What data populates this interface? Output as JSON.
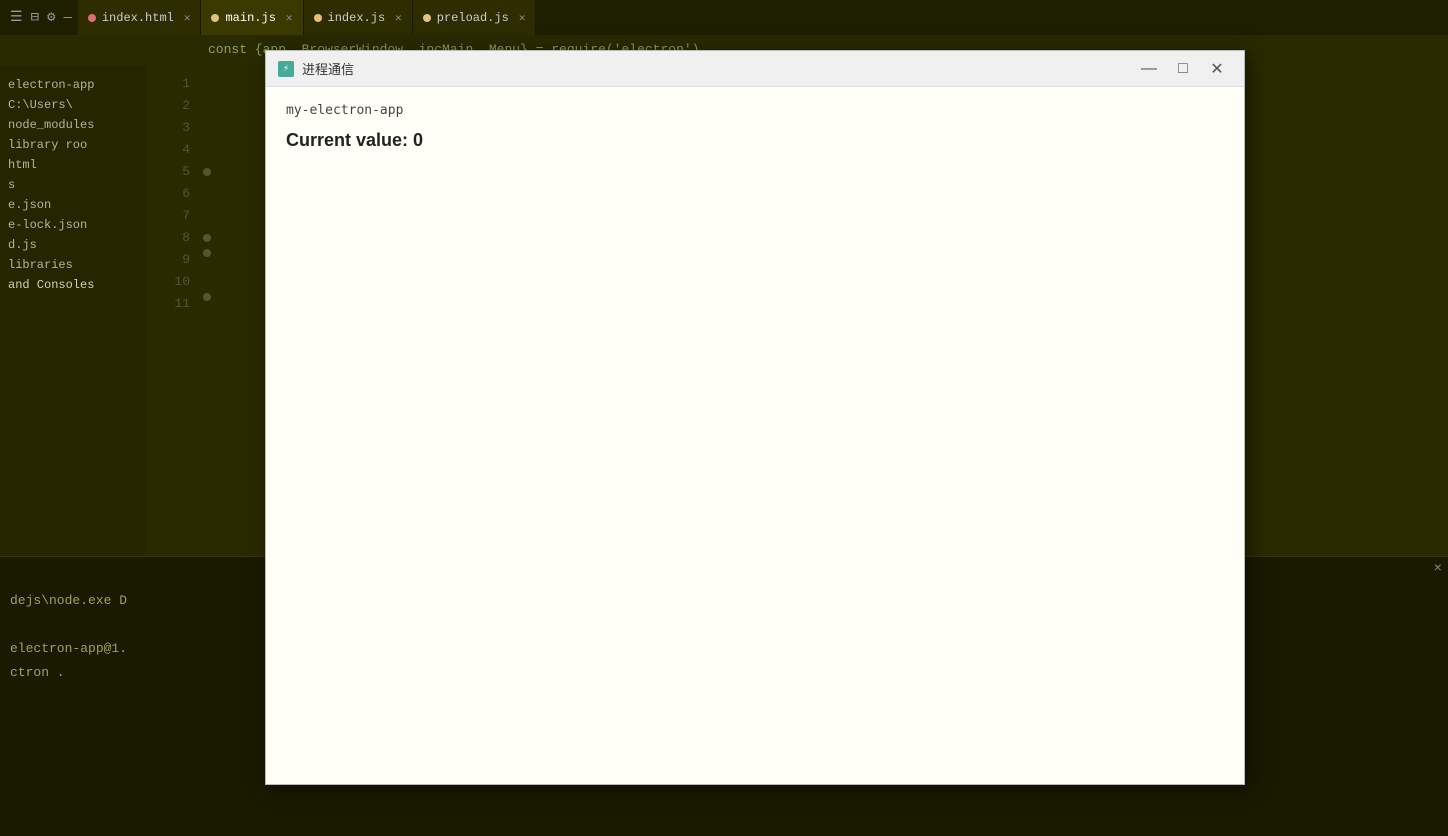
{
  "tabs": [
    {
      "id": "index-html",
      "label": "index.html",
      "type": "html",
      "active": false,
      "closable": true
    },
    {
      "id": "main-js",
      "label": "main.js",
      "type": "js",
      "active": true,
      "closable": true
    },
    {
      "id": "index-js",
      "label": "index.js",
      "type": "js",
      "active": false,
      "closable": true
    },
    {
      "id": "preload-js",
      "label": "preload.js",
      "type": "js",
      "active": false,
      "closable": true
    }
  ],
  "sidebar": {
    "items": [
      {
        "label": "electron-app",
        "type": "root"
      },
      {
        "label": "C:\\Users\\",
        "type": "path"
      },
      {
        "label": "node_modules",
        "type": "folder"
      },
      {
        "label": "library roo",
        "type": "folder"
      },
      {
        "label": "html",
        "type": "folder"
      },
      {
        "label": "s",
        "type": "file"
      },
      {
        "label": "e.json",
        "type": "file"
      },
      {
        "label": "e-lock.json",
        "type": "file"
      },
      {
        "label": "d.js",
        "type": "file"
      },
      {
        "label": "libraries",
        "type": "folder"
      },
      {
        "label": "and Consoles",
        "type": "folder"
      }
    ]
  },
  "line_numbers": [
    1,
    2,
    3,
    4,
    5,
    6,
    7,
    8,
    9,
    10,
    11
  ],
  "top_code": "const {app, BrowserWindow, ipcMain, Menu} = require('electron')",
  "terminal": {
    "close_label": "×",
    "lines": [
      "",
      "dejs\\node.exe D",
      "",
      "electron-app@1.",
      "ctron ."
    ]
  },
  "dialog": {
    "icon_label": "⚡",
    "title": "进程通信",
    "minimize_label": "—",
    "maximize_label": "□",
    "close_label": "✕",
    "app_name": "my-electron-app",
    "current_value_label": "Current value:",
    "current_value": "0"
  }
}
